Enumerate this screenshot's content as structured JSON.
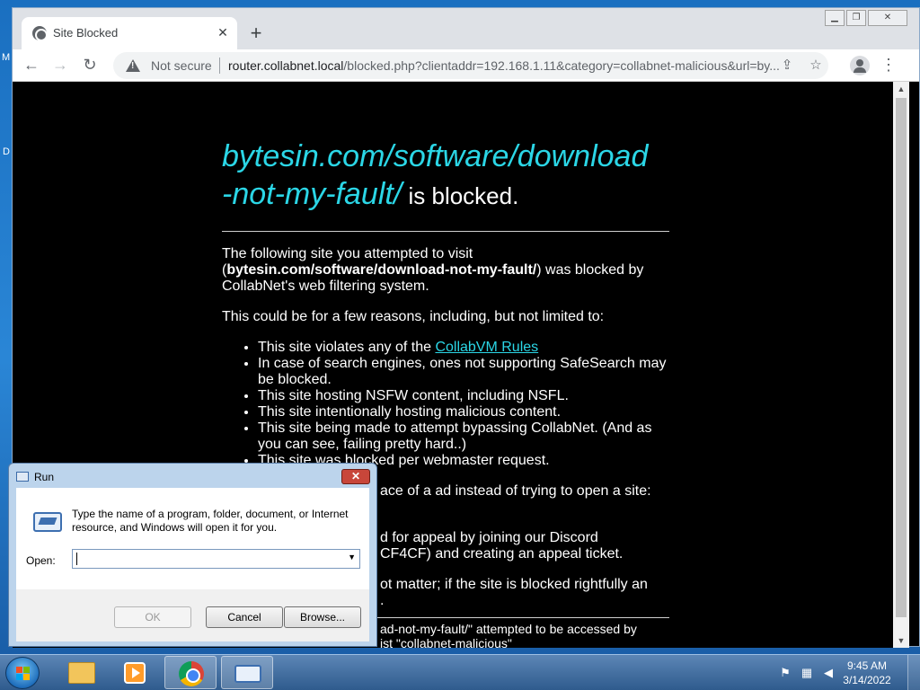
{
  "browser": {
    "tab_title": "Site Blocked",
    "tab_close": "✕",
    "new_tab": "+",
    "security_label": "Not secure",
    "url_host": "router.collabnet.local",
    "url_rest": "/blocked.php?clientaddr=192.168.1.11&category=collabnet-malicious&url=by..."
  },
  "page": {
    "blocked_url_line1": "bytesin.com/software/download",
    "blocked_url_line2": "-not-my-fault/",
    "blocked_suffix": " is blocked.",
    "intro_pre": "The following site you attempted to visit (",
    "intro_site": "bytesin.com/software/download-not-my-fault/",
    "intro_post": ") was blocked by CollabNet's web filtering system.",
    "reasons_intro": "This could be for a few reasons, including, but not limited to:",
    "reason_1_pre": "This site violates any of the ",
    "reason_1_link": "CollabVM Rules",
    "reasons": [
      "In case of search engines, ones not supporting SafeSearch may be blocked.",
      "This site hosting NSFW content, including NSFL.",
      "This site intentionally hosting malicious content.",
      "This site being made to attempt bypassing CollabNet. (And as you can see, failing pretty hard..)",
      "This site was blocked per webmaster request."
    ],
    "partial_para_1": "ace of a ad instead of trying to open a site:",
    "partial_para_2_line1": "d for appeal by joining our Discord",
    "partial_para_2_line2": "CF4CF) and creating an appeal ticket.",
    "partial_para_3_line1": "ot matter; if the site is blocked rightfully an",
    "partial_para_3_line2": ".",
    "footnote_line1": "ad-not-my-fault/\" attempted to be accessed by",
    "footnote_line2": "ist \"collabnet-malicious\""
  },
  "run_dialog": {
    "title": "Run",
    "close": "✕",
    "description": "Type the name of a program, folder, document, or Internet resource, and Windows will open it for you.",
    "open_label": "Open:",
    "open_value": "",
    "ok": "OK",
    "cancel": "Cancel",
    "browse": "Browse..."
  },
  "taskbar": {
    "time": "9:45 AM",
    "date": "3/14/2022"
  },
  "desktop": {
    "glyph_m": "M",
    "glyph_d": "D"
  }
}
